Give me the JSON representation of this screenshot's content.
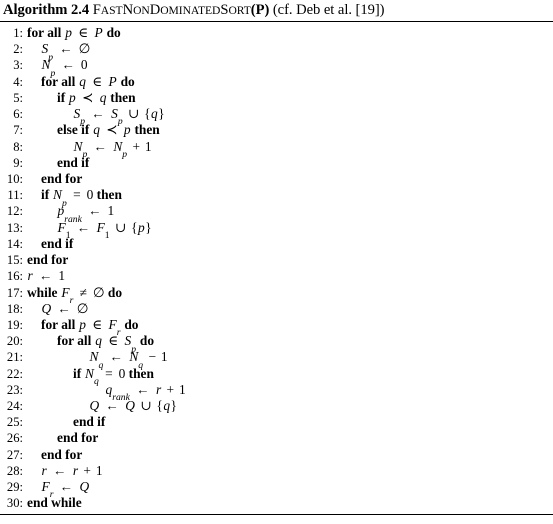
{
  "caption": {
    "label": "Algorithm",
    "number": "2.4",
    "procedure_name": "FastNonDominatedSort",
    "procedure_smallcaps_parts": [
      "F",
      "AST",
      "N",
      "ON",
      "D",
      "OMINATED",
      "S",
      "ORT"
    ],
    "argument": "(P)",
    "reference": "(cf. Deb et al. [19])",
    "full_title": "Algorithm 2.4 FastNonDominatedSort(P) (cf. Deb et al. [19])"
  },
  "colors": {
    "text": "#000000",
    "background": "#ffffff",
    "rule": "#000000"
  },
  "lines": [
    {
      "n": "1:",
      "indent": 0,
      "text": "for all p ∈ P do"
    },
    {
      "n": "2:",
      "indent": 1,
      "text": "S_p ← ∅"
    },
    {
      "n": "3:",
      "indent": 1,
      "text": "N_p ← 0"
    },
    {
      "n": "4:",
      "indent": 1,
      "text": "for all q ∈ P do"
    },
    {
      "n": "5:",
      "indent": 2,
      "text": "if p ≺ q then"
    },
    {
      "n": "6:",
      "indent": 3,
      "text": "S_p ← S_p ∪ {q}"
    },
    {
      "n": "7:",
      "indent": 2,
      "text": "else if q ≺ p then"
    },
    {
      "n": "8:",
      "indent": 3,
      "text": "N_p ← N_p + 1"
    },
    {
      "n": "9:",
      "indent": 2,
      "text": "end if"
    },
    {
      "n": "10:",
      "indent": 1,
      "text": "end for"
    },
    {
      "n": "11:",
      "indent": 1,
      "text": "if N_p = 0 then"
    },
    {
      "n": "12:",
      "indent": 2,
      "text": "p_rank ← 1"
    },
    {
      "n": "13:",
      "indent": 2,
      "text": "F_1 ← F_1 ∪ {p}"
    },
    {
      "n": "14:",
      "indent": 1,
      "text": "end if"
    },
    {
      "n": "15:",
      "indent": 0,
      "text": "end for"
    },
    {
      "n": "16:",
      "indent": 0,
      "text": "r ← 1"
    },
    {
      "n": "17:",
      "indent": 0,
      "text": "while F_r ≠ ∅ do"
    },
    {
      "n": "18:",
      "indent": 1,
      "text": "Q ← ∅"
    },
    {
      "n": "19:",
      "indent": 1,
      "text": "for all p ∈ F_r do"
    },
    {
      "n": "20:",
      "indent": 2,
      "text": "for all q ∈ S_p do"
    },
    {
      "n": "21:",
      "indent": 3,
      "text": "N_q ← N_q − 1"
    },
    {
      "n": "22:",
      "indent": 3,
      "text": "if N_q = 0 then"
    },
    {
      "n": "23:",
      "indent": 4,
      "text": "q_rank ← r + 1"
    },
    {
      "n": "24:",
      "indent": 4,
      "text": "Q ← Q ∪ {q}"
    },
    {
      "n": "25:",
      "indent": 3,
      "text": "end if"
    },
    {
      "n": "26:",
      "indent": 2,
      "text": "end for"
    },
    {
      "n": "27:",
      "indent": 1,
      "text": "end for"
    },
    {
      "n": "28:",
      "indent": 1,
      "text": "r ← r + 1"
    },
    {
      "n": "29:",
      "indent": 1,
      "text": "F_r ← Q"
    },
    {
      "n": "30:",
      "indent": 0,
      "text": "end while"
    }
  ]
}
